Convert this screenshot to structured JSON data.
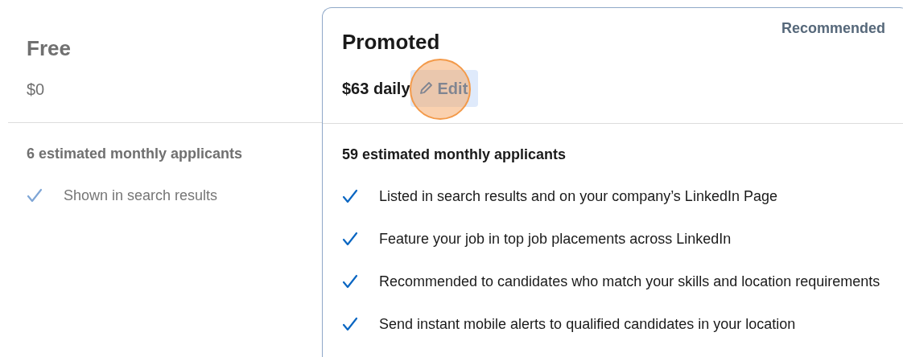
{
  "plans": [
    {
      "name": "Free",
      "price": "$0",
      "selected": false,
      "applicants": "6 estimated monthly applicants",
      "features": [
        "Shown in search results"
      ]
    },
    {
      "name": "Promoted",
      "badge": "Recommended",
      "price": "$63 daily",
      "edit_button": {
        "label": "Edit",
        "clicked": true
      },
      "selected": true,
      "applicants": "59 estimated monthly applicants",
      "features": [
        "Listed in search results and on your company’s LinkedIn Page",
        "Feature your job in top job placements across LinkedIn",
        "Recommended to candidates who match your skills and location requirements",
        "Send instant mobile alerts to qualified candidates in your location"
      ]
    }
  ]
}
